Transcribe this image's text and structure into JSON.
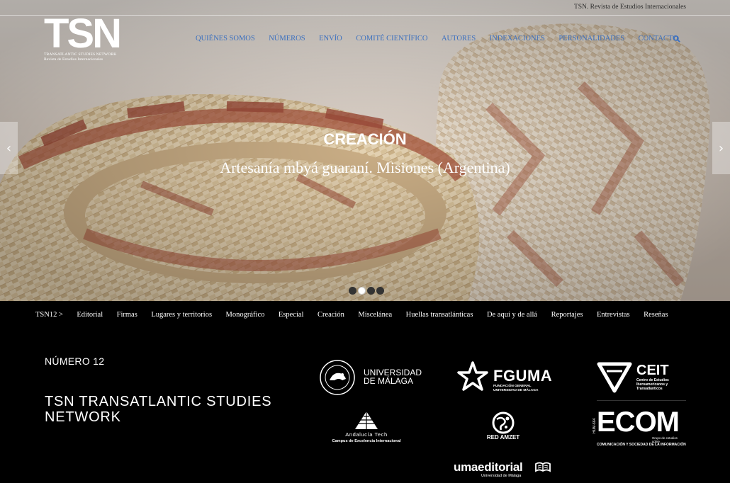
{
  "topbar": {
    "site_name": "TSN. Revista de Estudios Internacionales"
  },
  "logo": {
    "wordmark": "TSN",
    "subtitle_1": "TRANSATLANTIC STUDIES NETWORK",
    "subtitle_2": "Revista de Estudios Internacionales"
  },
  "nav": {
    "items": [
      "QUIÉNES SOMOS",
      "NÚMEROS",
      "ENVÍO",
      "COMITÉ CIENTÍFICO",
      "AUTORES",
      "INDEXACIONES",
      "PERSONALIDADES",
      "CONTACTO"
    ],
    "search_icon": "search-icon"
  },
  "slider": {
    "title": "CREACIÓN",
    "subtitle": "Artesanía mbyá guaraní. Misiones (Argentina)",
    "prev_icon": "‹",
    "next_icon": "›",
    "dots": 4,
    "active_dot": 1
  },
  "section_nav": {
    "items": [
      "TSN12 >",
      "Editorial",
      "Firmas",
      "Lugares y territorios",
      "Monográfico",
      "Especial",
      "Creación",
      "Miscelánea",
      "Huellas transatlánticas",
      "De aquí y de allá",
      "Reportajes",
      "Entrevistas",
      "Reseñas"
    ]
  },
  "footer": {
    "issue": "NÚMERO 12",
    "journal": "TSN TRANSATLANTIC STUDIES NETWORK",
    "sponsors": {
      "uma": {
        "line1": "UNIVERSIDAD",
        "line2": "DE MÁLAGA"
      },
      "fguma": {
        "name": "FGUMA",
        "line1": "FUNDACIÓN GENERAL",
        "line2": "UNIVERSIDAD DE MÁLAGA"
      },
      "ceit": {
        "name": "CEIT",
        "desc": "Centro de Estudios Iberoamericanos y Transatlánticos"
      },
      "andalucia_tech": {
        "name": "Andalucía Tech",
        "desc": "Campus de Excelencia Internacional"
      },
      "red_amzet": {
        "name": "RED AMZET"
      },
      "ecom": {
        "tag": "HUM-664",
        "name": "ECOM",
        "desc": "Grupo de estudios sobre",
        "desc2": "COMUNICACIÓN Y SOCIEDAD DE LA INFORMACIÓN"
      },
      "umaeditorial": {
        "name": "umaeditorial",
        "desc": "Universidad de Málaga"
      }
    }
  },
  "colors": {
    "nav_link": "#3a6fbf",
    "footer_bg": "#000000",
    "text_light": "#ffffff"
  }
}
